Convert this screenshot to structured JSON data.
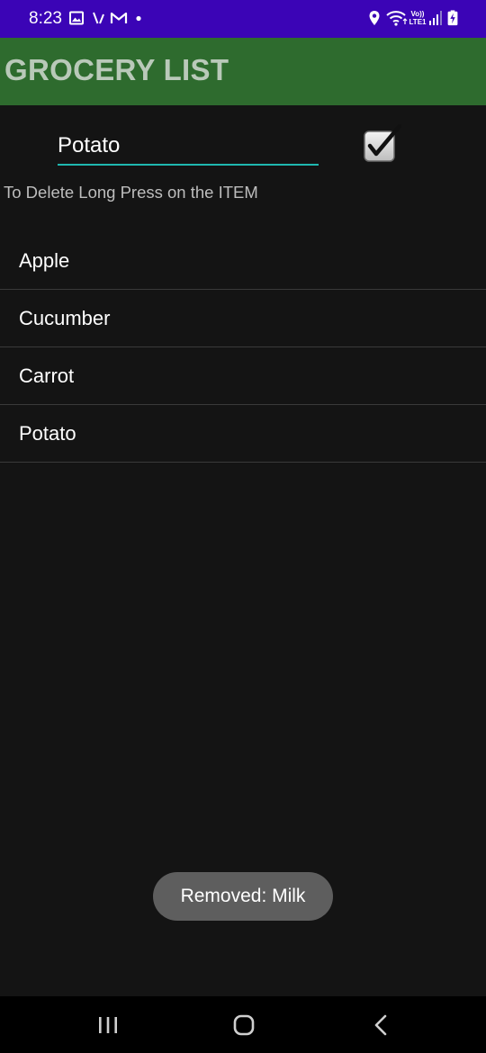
{
  "status_bar": {
    "time": "8:23",
    "icons": [
      "gallery-icon",
      "vpn-slash-icon",
      "gmail-icon",
      "dot-icon",
      "location-icon",
      "wifi-icon",
      "volte-icon",
      "signal-icon",
      "battery-charging-icon"
    ],
    "lte_label": "Vo)) LTE1",
    "background": "#3b04b6"
  },
  "app_bar": {
    "title": "GROCERY LIST",
    "background": "#2e6b2e"
  },
  "input": {
    "value": "Potato",
    "underline_color": "#1fb8b0"
  },
  "add_checkbox": {
    "checked": true,
    "icon": "checkbox-checked-icon"
  },
  "hint": "To Delete Long Press on the ITEM",
  "items": [
    {
      "label": "Apple"
    },
    {
      "label": "Cucumber"
    },
    {
      "label": "Carrot"
    },
    {
      "label": "Potato"
    }
  ],
  "toast": "Removed: Milk",
  "nav_bar": {
    "buttons": [
      "recents-icon",
      "home-icon",
      "back-icon"
    ]
  }
}
